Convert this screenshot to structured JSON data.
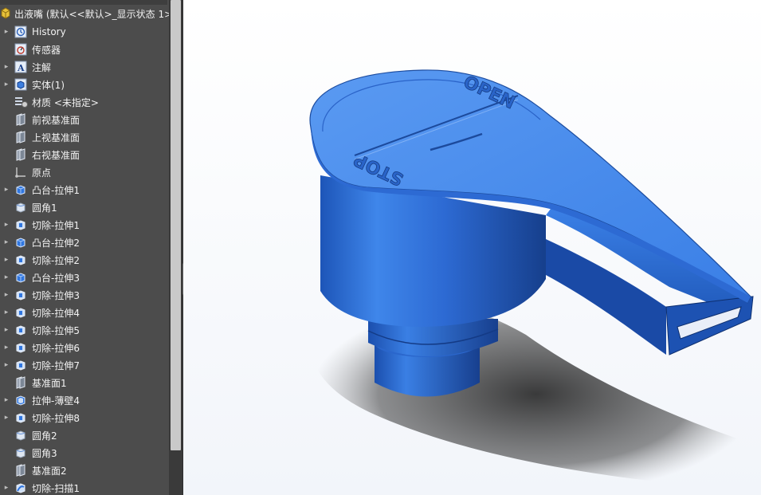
{
  "feature_tree": {
    "root_label": "出液嘴 (默认<<默认>_显示状态 1>",
    "items": [
      {
        "label": "History",
        "icon": "history-icon",
        "expandable": true
      },
      {
        "label": "传感器",
        "icon": "sensor-icon",
        "expandable": false
      },
      {
        "label": "注解",
        "icon": "annotation-icon",
        "expandable": true
      },
      {
        "label": "实体(1)",
        "icon": "solid-bodies-icon",
        "expandable": true
      },
      {
        "label": "材质 <未指定>",
        "icon": "material-icon",
        "expandable": false
      },
      {
        "label": "前视基准面",
        "icon": "plane-icon",
        "expandable": false
      },
      {
        "label": "上视基准面",
        "icon": "plane-icon",
        "expandable": false
      },
      {
        "label": "右视基准面",
        "icon": "plane-icon",
        "expandable": false
      },
      {
        "label": "原点",
        "icon": "origin-icon",
        "expandable": false
      },
      {
        "label": "凸台-拉伸1",
        "icon": "boss-extrude-icon",
        "expandable": true
      },
      {
        "label": "圆角1",
        "icon": "fillet-icon",
        "expandable": false
      },
      {
        "label": "切除-拉伸1",
        "icon": "cut-extrude-icon",
        "expandable": true
      },
      {
        "label": "凸台-拉伸2",
        "icon": "boss-extrude-icon",
        "expandable": true
      },
      {
        "label": "切除-拉伸2",
        "icon": "cut-extrude-icon",
        "expandable": true
      },
      {
        "label": "凸台-拉伸3",
        "icon": "boss-extrude-icon",
        "expandable": true
      },
      {
        "label": "切除-拉伸3",
        "icon": "cut-extrude-icon",
        "expandable": true
      },
      {
        "label": "切除-拉伸4",
        "icon": "cut-extrude-icon",
        "expandable": true
      },
      {
        "label": "切除-拉伸5",
        "icon": "cut-extrude-icon",
        "expandable": true
      },
      {
        "label": "切除-拉伸6",
        "icon": "cut-extrude-icon",
        "expandable": true
      },
      {
        "label": "切除-拉伸7",
        "icon": "cut-extrude-icon",
        "expandable": true
      },
      {
        "label": "基准面1",
        "icon": "plane-icon",
        "expandable": false
      },
      {
        "label": "拉伸-薄壁4",
        "icon": "thin-extrude-icon",
        "expandable": true
      },
      {
        "label": "切除-拉伸8",
        "icon": "cut-extrude-icon",
        "expandable": true
      },
      {
        "label": "圆角2",
        "icon": "fillet-icon",
        "expandable": false
      },
      {
        "label": "圆角3",
        "icon": "fillet-icon",
        "expandable": false
      },
      {
        "label": "基准面2",
        "icon": "plane-icon",
        "expandable": false
      },
      {
        "label": "切除-扫描1",
        "icon": "cut-sweep-icon",
        "expandable": true
      }
    ]
  },
  "model": {
    "lid_text_top": "OPEN",
    "lid_text_bottom": "STOP",
    "body_color": "#2f6fd6",
    "lid_color": "#4a8ef0"
  }
}
